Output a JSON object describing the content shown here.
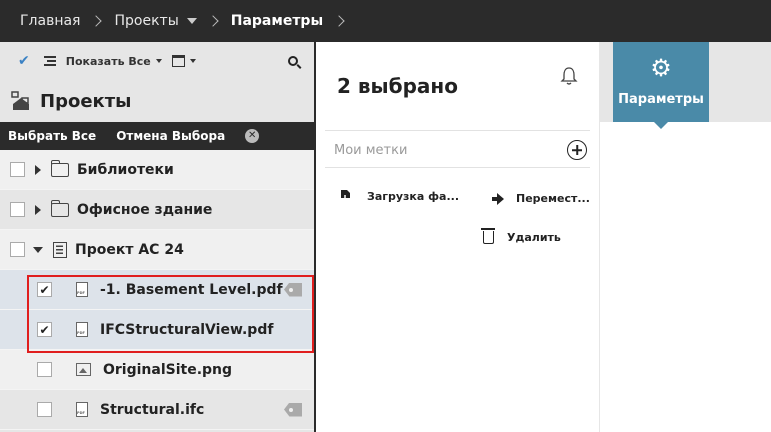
{
  "breadcrumb": {
    "home": "Главная",
    "projects": "Проекты",
    "current": "Параметры"
  },
  "toolbar": {
    "show_all": "Показать Все"
  },
  "projects_panel": {
    "title": "Проекты",
    "select_all": "Выбрать Все",
    "deselect": "Отмена Выбора",
    "rows": [
      {
        "label": "Библиотеки",
        "checked": false
      },
      {
        "label": "Офисное здание",
        "checked": false
      },
      {
        "label": "Проект AC 24",
        "checked": false
      },
      {
        "label": "-1. Basement Level.pdf",
        "checked": true
      },
      {
        "label": "IFCStructuralView.pdf",
        "checked": true
      },
      {
        "label": "OriginalSite.png",
        "checked": false
      },
      {
        "label": "Structural.ifc",
        "checked": false
      }
    ],
    "check_glyph": "✔"
  },
  "selection_panel": {
    "count_text": "2 выбрано",
    "tags_placeholder": "Мои метки",
    "actions": {
      "download": "Загрузка фа...",
      "move": "Перемест...",
      "delete": "Удалить"
    }
  },
  "right_panel": {
    "tab_label": "Параметры",
    "gear_glyph": "⚙"
  },
  "colors": {
    "accent": "#4a8aa8",
    "dark": "#2b2b2b",
    "highlight": "#e01e1e"
  }
}
